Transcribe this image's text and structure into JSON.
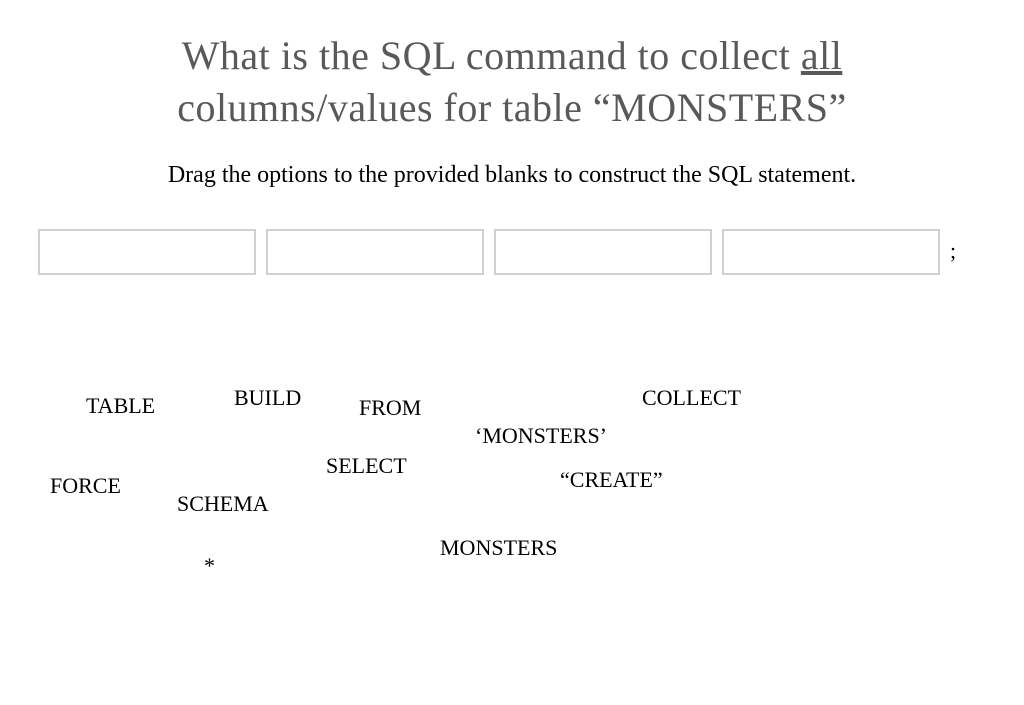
{
  "title": {
    "line1_prefix": "What is the SQL command to collect ",
    "line1_underlined": "all",
    "line2": "columns/values for table “MONSTERS”"
  },
  "instruction": "Drag the options to the provided blanks to construct the SQL statement.",
  "semicolon": ";",
  "options": {
    "table": "TABLE",
    "build": "BUILD",
    "from": "FROM",
    "collect": "COLLECT",
    "monsters_quoted": "‘MONSTERS’",
    "select": "SELECT",
    "force": "FORCE",
    "create_quoted": "“CREATE”",
    "schema": "SCHEMA",
    "monsters": "MONSTERS",
    "star": "*"
  }
}
